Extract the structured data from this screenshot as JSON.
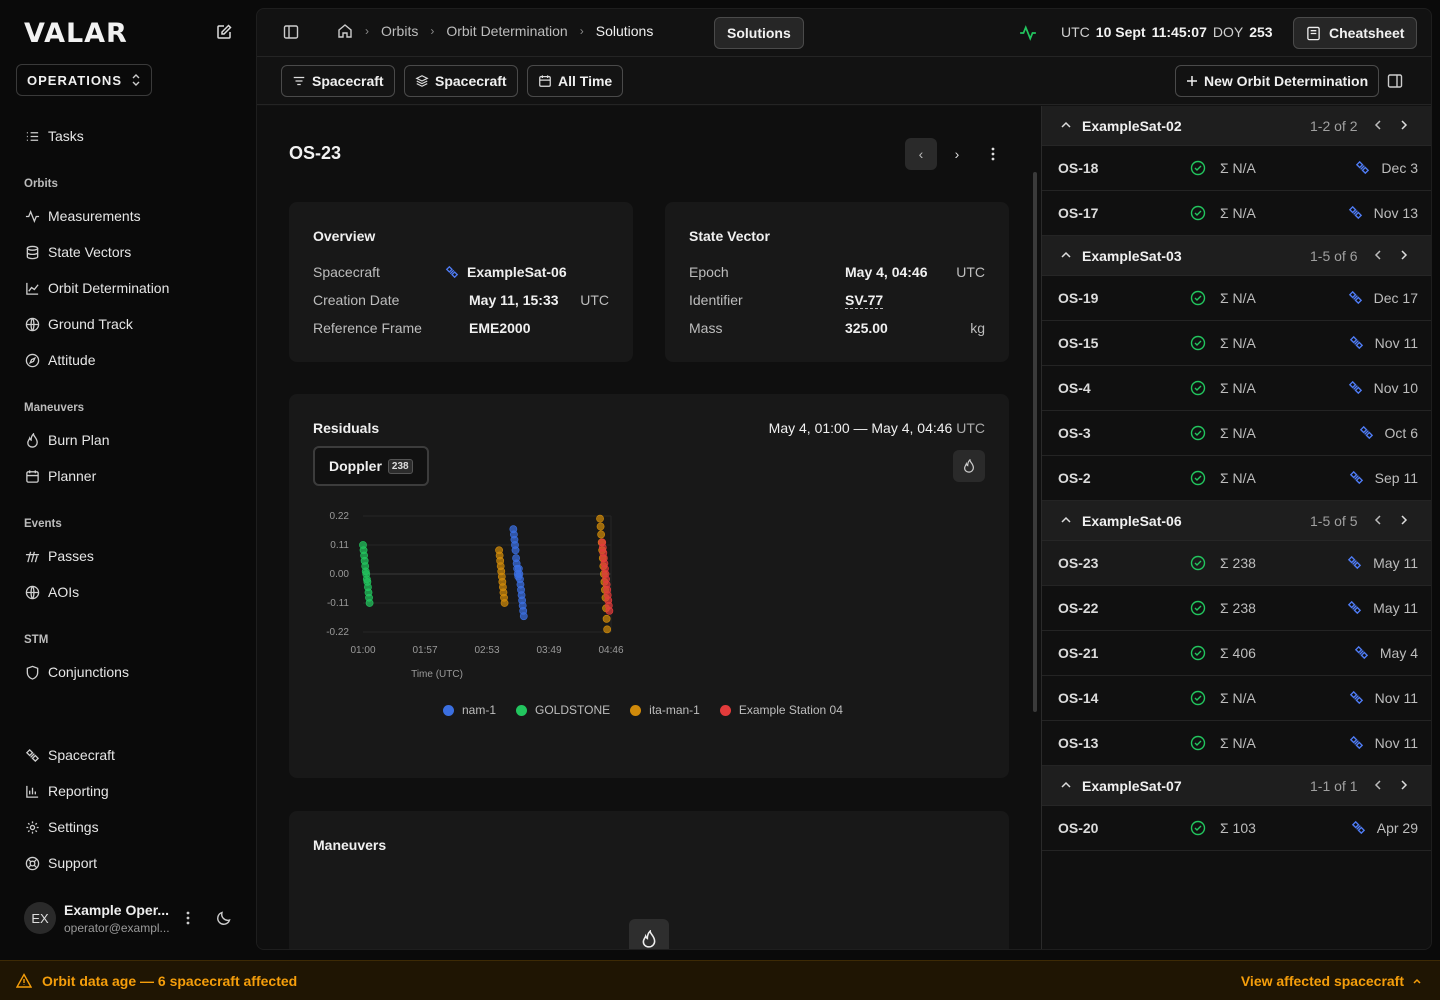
{
  "app": {
    "logo": "VALAR",
    "org": "OPERATIONS"
  },
  "sidebar": {
    "tasks": "Tasks",
    "sections": {
      "orbits": "Orbits",
      "maneuvers": "Maneuvers",
      "events": "Events",
      "stm": "STM"
    },
    "items": {
      "measurements": "Measurements",
      "state_vectors": "State Vectors",
      "orbit_determination": "Orbit Determination",
      "ground_track": "Ground Track",
      "attitude": "Attitude",
      "burn_plan": "Burn Plan",
      "planner": "Planner",
      "passes": "Passes",
      "aois": "AOIs",
      "conjunctions": "Conjunctions",
      "spacecraft": "Spacecraft",
      "reporting": "Reporting",
      "settings": "Settings",
      "support": "Support"
    },
    "user": {
      "initials": "EX",
      "name": "Example Oper...",
      "email": "operator@exampl..."
    }
  },
  "topbar": {
    "breadcrumbs": [
      "Orbits",
      "Orbit Determination",
      "Solutions"
    ],
    "current_button": "Solutions",
    "clock": {
      "tz": "UTC",
      "date": "10 Sept",
      "time": "11:45:07",
      "doy_label": "DOY",
      "doy": "253"
    },
    "cheatsheet": "Cheatsheet"
  },
  "filters": {
    "f1": "Spacecraft",
    "f2": "Spacecraft",
    "f3": "All Time",
    "new_button": "New Orbit Determination"
  },
  "detail": {
    "title": "OS-23",
    "overview": {
      "title": "Overview",
      "spacecraft_label": "Spacecraft",
      "spacecraft_value": "ExampleSat-06",
      "creation_label": "Creation Date",
      "creation_value": "May 11, 15:33",
      "creation_unit": "UTC",
      "frame_label": "Reference Frame",
      "frame_value": "EME2000"
    },
    "state_vector": {
      "title": "State Vector",
      "epoch_label": "Epoch",
      "epoch_value": "May 4, 04:46",
      "epoch_unit": "UTC",
      "identifier_label": "Identifier",
      "identifier_value": "SV-77",
      "mass_label": "Mass",
      "mass_value": "325.00",
      "mass_unit": "kg"
    },
    "residuals": {
      "title": "Residuals",
      "range": "May 4, 01:00 — May 4, 04:46",
      "range_unit": "UTC",
      "tab_label": "Doppler",
      "tab_count": "238"
    },
    "maneuvers": {
      "title": "Maneuvers"
    }
  },
  "chart_data": {
    "type": "scatter",
    "title": "",
    "xlabel": "Time (UTC)",
    "ylabel": "",
    "x_ticks": [
      "01:00",
      "01:57",
      "02:53",
      "03:49",
      "04:46"
    ],
    "y_ticks": [
      "0.22",
      "0.11",
      "0.00",
      "-0.11",
      "-0.22"
    ],
    "ylim": [
      -0.22,
      0.22
    ],
    "xlim_minutes_after_01_00": [
      0,
      226
    ],
    "grid": "horizontal",
    "legend_position": "bottom",
    "series": [
      {
        "name": "nam-1",
        "color": "#3b6fe0",
        "points": [
          [
            137,
            0.17
          ],
          [
            137.5,
            0.15
          ],
          [
            138,
            0.13
          ],
          [
            138.5,
            0.11
          ],
          [
            139,
            0.09
          ],
          [
            139.5,
            0.06
          ],
          [
            140,
            0.04
          ],
          [
            140.5,
            0.02
          ],
          [
            141,
            0.0
          ],
          [
            141.5,
            -0.01
          ],
          [
            142,
            0.02
          ],
          [
            142.5,
            0.0
          ],
          [
            143,
            -0.02
          ],
          [
            143.5,
            -0.04
          ],
          [
            144,
            -0.06
          ],
          [
            144.5,
            -0.08
          ],
          [
            145,
            -0.1
          ],
          [
            145.5,
            -0.12
          ],
          [
            146,
            -0.14
          ],
          [
            146.5,
            -0.16
          ]
        ]
      },
      {
        "name": "GOLDSTONE",
        "color": "#22c55e",
        "points": [
          [
            0,
            0.11
          ],
          [
            0.5,
            0.09
          ],
          [
            1,
            0.07
          ],
          [
            1.5,
            0.05
          ],
          [
            2,
            0.03
          ],
          [
            2.5,
            0.01
          ],
          [
            3,
            0.0
          ],
          [
            3.5,
            -0.02
          ],
          [
            4,
            -0.03
          ],
          [
            4.5,
            -0.05
          ],
          [
            5,
            -0.07
          ],
          [
            5.5,
            -0.09
          ],
          [
            6,
            -0.11
          ]
        ]
      },
      {
        "name": "ita-man-1",
        "color": "#d08a0a",
        "points": [
          [
            124,
            0.09
          ],
          [
            124.5,
            0.07
          ],
          [
            125,
            0.05
          ],
          [
            125.5,
            0.03
          ],
          [
            126,
            0.01
          ],
          [
            126.5,
            -0.01
          ],
          [
            127,
            -0.03
          ],
          [
            127.5,
            -0.05
          ],
          [
            128,
            -0.07
          ],
          [
            128.5,
            -0.09
          ],
          [
            129,
            -0.11
          ],
          [
            216,
            0.21
          ],
          [
            216.5,
            0.18
          ],
          [
            217,
            0.15
          ],
          [
            217.5,
            0.12
          ],
          [
            218,
            0.09
          ],
          [
            218.5,
            0.06
          ],
          [
            219,
            0.03
          ],
          [
            219.5,
            0.0
          ],
          [
            220,
            -0.03
          ],
          [
            220.5,
            -0.06
          ],
          [
            221,
            -0.09
          ],
          [
            221.5,
            -0.13
          ],
          [
            222,
            -0.17
          ],
          [
            222.5,
            -0.21
          ]
        ]
      },
      {
        "name": "Example Station 04",
        "color": "#e23b3b",
        "points": [
          [
            218,
            0.12
          ],
          [
            218.5,
            0.1
          ],
          [
            219,
            0.08
          ],
          [
            219.5,
            0.06
          ],
          [
            220,
            0.04
          ],
          [
            220.5,
            0.02
          ],
          [
            221,
            0.0
          ],
          [
            221.5,
            -0.02
          ],
          [
            222,
            -0.04
          ],
          [
            222.5,
            -0.06
          ],
          [
            223,
            -0.08
          ],
          [
            223.5,
            -0.1
          ],
          [
            224,
            -0.12
          ],
          [
            224.5,
            -0.14
          ]
        ]
      }
    ]
  },
  "groups": [
    {
      "name": "ExampleSat-02",
      "count": "1-2 of 2",
      "rows": [
        {
          "id": "OS-18",
          "sigma": "N/A",
          "date": "Dec 3"
        },
        {
          "id": "OS-17",
          "sigma": "N/A",
          "date": "Nov 13"
        }
      ]
    },
    {
      "name": "ExampleSat-03",
      "count": "1-5 of 6",
      "rows": [
        {
          "id": "OS-19",
          "sigma": "N/A",
          "date": "Dec 17"
        },
        {
          "id": "OS-15",
          "sigma": "N/A",
          "date": "Nov 11"
        },
        {
          "id": "OS-4",
          "sigma": "N/A",
          "date": "Nov 10"
        },
        {
          "id": "OS-3",
          "sigma": "N/A",
          "date": "Oct 6"
        },
        {
          "id": "OS-2",
          "sigma": "N/A",
          "date": "Sep 11"
        }
      ]
    },
    {
      "name": "ExampleSat-06",
      "count": "1-5 of 5",
      "rows": [
        {
          "id": "OS-23",
          "sigma": "238",
          "date": "May 11",
          "selected": true
        },
        {
          "id": "OS-22",
          "sigma": "238",
          "date": "May 11"
        },
        {
          "id": "OS-21",
          "sigma": "406",
          "date": "May 4"
        },
        {
          "id": "OS-14",
          "sigma": "N/A",
          "date": "Nov 11"
        },
        {
          "id": "OS-13",
          "sigma": "N/A",
          "date": "Nov 11"
        }
      ]
    },
    {
      "name": "ExampleSat-07",
      "count": "1-1 of 1",
      "rows": [
        {
          "id": "OS-20",
          "sigma": "103",
          "date": "Apr 29"
        }
      ]
    }
  ],
  "footer": {
    "warning": "Orbit data age — 6 spacecraft affected",
    "action": "View affected spacecraft"
  },
  "colors": {
    "accent_warning": "#f59e0b",
    "ok": "#22c55e",
    "sat_icon": "#4f7cf5"
  }
}
